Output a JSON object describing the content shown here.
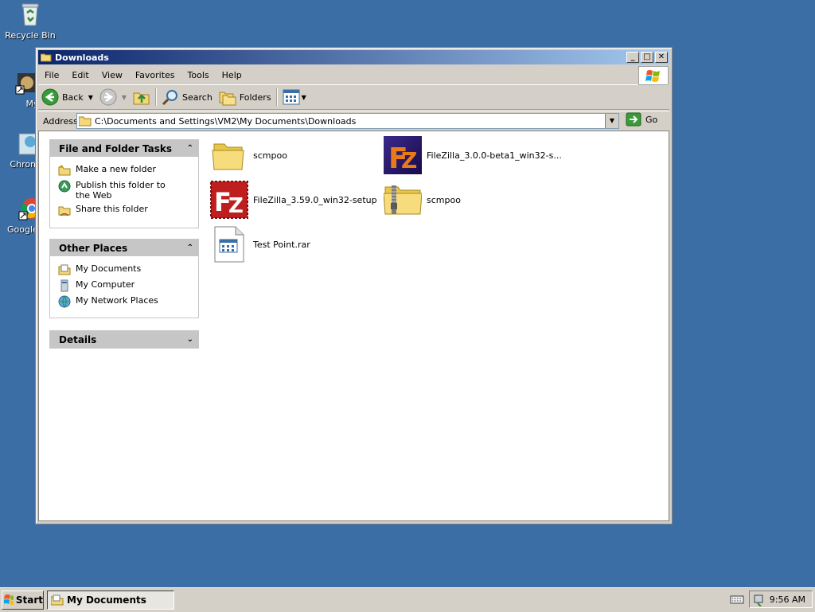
{
  "desktop": {
    "icons": [
      {
        "label": "Recycle Bin"
      },
      {
        "label": "Myp"
      },
      {
        "label": "Chrome"
      },
      {
        "label": "Google C"
      }
    ]
  },
  "window": {
    "title": "Downloads",
    "menu": [
      "File",
      "Edit",
      "View",
      "Favorites",
      "Tools",
      "Help"
    ],
    "toolbar": {
      "back": "Back",
      "search": "Search",
      "folders": "Folders"
    },
    "address": {
      "label": "Address",
      "value": "C:\\Documents and Settings\\VM2\\My Documents\\Downloads",
      "go": "Go"
    },
    "tasks_panel": {
      "title": "File and Folder Tasks",
      "items": [
        "Make a new folder",
        "Publish this folder to the Web",
        "Share this folder"
      ]
    },
    "places_panel": {
      "title": "Other Places",
      "items": [
        "My Documents",
        "My Computer",
        "My Network Places"
      ]
    },
    "details_panel": {
      "title": "Details"
    },
    "files": [
      {
        "name": "scmpoo",
        "type": "folder"
      },
      {
        "name": "FileZilla_3.0.0-beta1_win32-s...",
        "type": "filezilla-old"
      },
      {
        "name": "FileZilla_3.59.0_win32-setup",
        "type": "filezilla-new"
      },
      {
        "name": "scmpoo",
        "type": "zip-folder"
      },
      {
        "name": "Test Point.rar",
        "type": "rar"
      }
    ]
  },
  "taskbar": {
    "start": "Start",
    "active_task": "My Documents",
    "clock": "9:56 AM"
  },
  "colors": {
    "desktop": "#3a6ea5",
    "titlebar_start": "#0a246a",
    "titlebar_end": "#a6caf0"
  }
}
